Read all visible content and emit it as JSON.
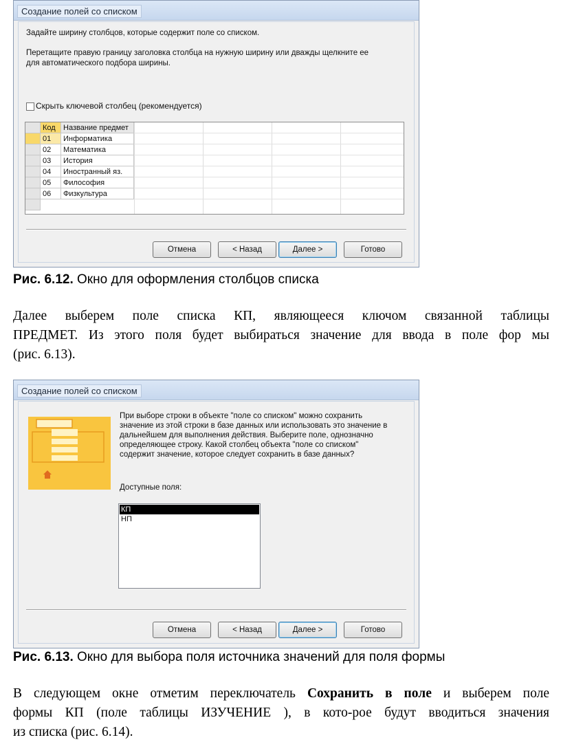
{
  "window1": {
    "title": "Создание полей со списком",
    "instr1": "Задайте ширину столбцов, которые содержит поле со списком.",
    "instr2a": "Перетащите правую границу заголовка столбца на нужную ширину или дважды щелкните ее",
    "instr2b": "для автоматического подбора ширины.",
    "checkbox_label": "Скрыть ключевой столбец (рекомендуется)",
    "grid": {
      "headers": [
        "Код",
        "Название предмет"
      ],
      "rows": [
        [
          "01",
          "Информатика"
        ],
        [
          "02",
          "Математика"
        ],
        [
          "03",
          "История"
        ],
        [
          "04",
          "Иностранный яз."
        ],
        [
          "05",
          "Философия"
        ],
        [
          "06",
          "Физкультура"
        ]
      ]
    },
    "buttons": {
      "cancel": "Отмена",
      "back": "< Назад",
      "next": "Далее >",
      "finish": "Готово"
    }
  },
  "caption1": {
    "num": "Рис. 6.12.",
    "text": " Окно для оформления столбцов списка"
  },
  "para1": {
    "l1": "Далее выберем поле списка КП, являющееся ключом связанной таблицы",
    "l2": "ПРЕДМЕТ. Из этого поля будет выбираться значение для ввода в поле фор мы",
    "l3": "(рис. 6.13)."
  },
  "window2": {
    "title": "Создание полей со списком",
    "desc1": "При выборе строки в объекте \"поле со списком\" можно сохранить",
    "desc2": "значение из этой строки в базе данных или использовать это значение в",
    "desc3": "дальнейшем для выполнения действия.  Выберите поле, однозначно",
    "desc4": "определяющее строку.  Какой столбец объекта \"поле со списком\"",
    "desc5": "содержит значение, которое следует сохранить в базе данных?",
    "fields_label": "Доступные поля:",
    "fields": [
      "КП",
      "НП"
    ],
    "buttons": {
      "cancel": "Отмена",
      "back": "< Назад",
      "next": "Далее >",
      "finish": "Готово"
    }
  },
  "caption2": {
    "num": "Рис. 6.13.",
    "text": " Окно для выбора поля источника значений для поля формы"
  },
  "para2": {
    "p1": "В следующем окне отметим переключатель ",
    "bold": "Сохранить в поле",
    "p2": " и выберем поле",
    "l2": "формы КП (поле таблицы ИЗУЧЕНИЕ ), в кото-рое будут вводиться значения",
    "l3": "из списка (рис. 6.14)."
  },
  "colors": {
    "wizard_yellow": "#f9c53f",
    "title_bar": "#c6d7ee",
    "dialog_bg": "#f0f0f0"
  }
}
